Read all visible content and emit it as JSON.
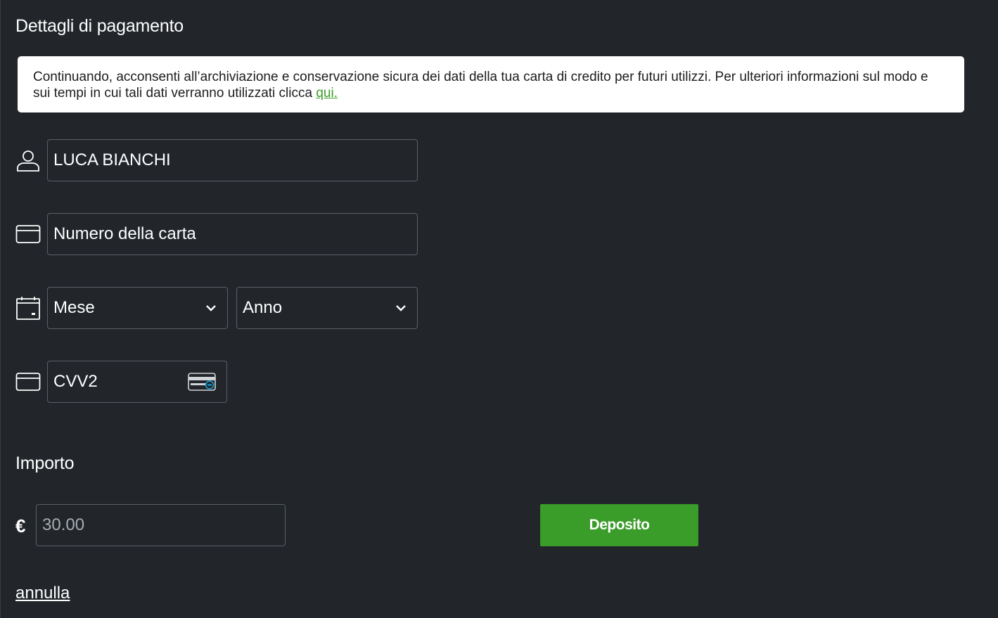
{
  "payment": {
    "title": "Dettagli di pagamento",
    "notice_text": "Continuando, acconsenti all’archiviazione e conservazione sicura dei dati della tua carta di credito per futuri utilizzi. Per ulteriori informazioni sul modo e sui tempi in cui tali dati verranno utilizzati clicca ",
    "notice_link": "qui."
  },
  "form": {
    "cardholder_value": "LUCA BIANCHI",
    "card_number_placeholder": "Numero della carta",
    "month_label": "Mese",
    "year_label": "Anno",
    "cvv_placeholder": "CVV2"
  },
  "amount": {
    "title": "Importo",
    "currency": "€",
    "placeholder": "30.00"
  },
  "actions": {
    "deposit_label": "Deposito",
    "cancel_label": "annulla"
  },
  "icons": {
    "user": "user-icon",
    "card": "credit-card-icon",
    "calendar": "calendar-icon",
    "chevron": "chevron-down-icon",
    "cvv": "cvv-card-icon"
  },
  "colors": {
    "background": "#22262b",
    "accent_green": "#3a9c29",
    "link_green": "#3c9c27",
    "border": "#5b6066"
  }
}
